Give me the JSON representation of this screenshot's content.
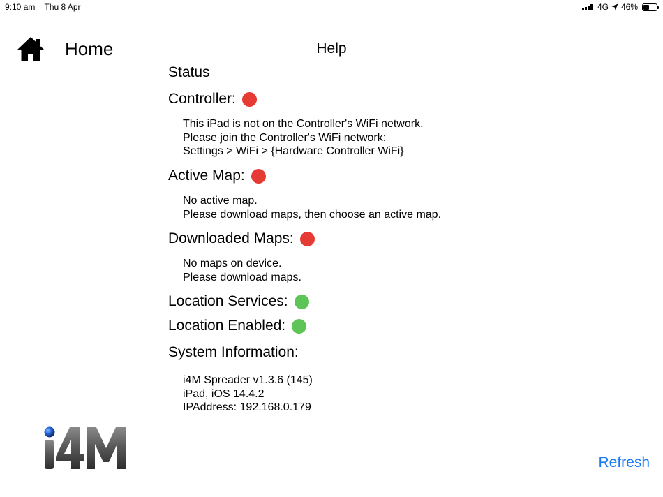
{
  "status_bar": {
    "time": "9:10 am",
    "date": "Thu 8 Apr",
    "network": "4G",
    "battery_percent": "46%",
    "battery_level": 0.46
  },
  "header": {
    "home_label": "Home",
    "title": "Help"
  },
  "status": {
    "heading": "Status",
    "controller": {
      "label": "Controller:",
      "state": "red",
      "lines": [
        "This iPad is not on the Controller's WiFi network.",
        "Please join the Controller's WiFi network:",
        "Settings > WiFi > {Hardware Controller WiFi}"
      ]
    },
    "active_map": {
      "label": "Active Map:",
      "state": "red",
      "lines": [
        "No active map.",
        "Please download maps, then choose an active map."
      ]
    },
    "downloaded_maps": {
      "label": "Downloaded Maps:",
      "state": "red",
      "lines": [
        "No maps on device.",
        "Please download maps."
      ]
    },
    "location_services": {
      "label": "Location Services:",
      "state": "green"
    },
    "location_enabled": {
      "label": "Location Enabled:",
      "state": "green"
    }
  },
  "system_information": {
    "heading": "System Information:",
    "lines": [
      "i4M Spreader v1.3.6 (145)",
      "iPad, iOS 14.4.2",
      "IPAddress: 192.168.0.179"
    ]
  },
  "logo": {
    "text": "i4M"
  },
  "refresh_label": "Refresh",
  "colors": {
    "status_red": "#e63b34",
    "status_green": "#5cc555",
    "link_blue": "#1a7cf5"
  }
}
